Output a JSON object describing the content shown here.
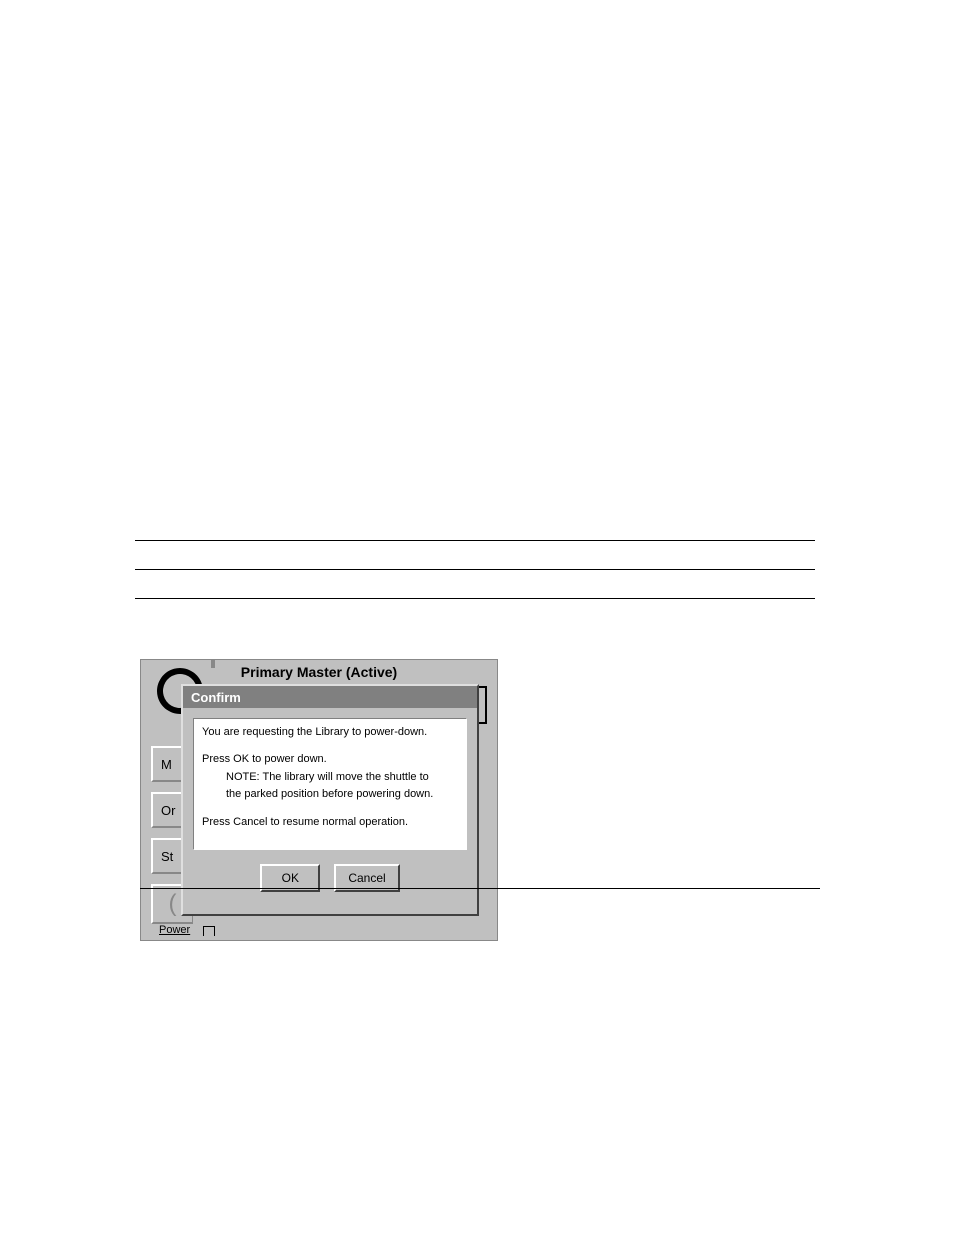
{
  "window": {
    "title": "Primary Master (Active)"
  },
  "sidebar": {
    "items": [
      "M",
      "Or",
      "St"
    ],
    "power_label": "Power"
  },
  "dialog": {
    "title": "Confirm",
    "message": {
      "line1": "You are requesting the Library to power-down.",
      "line2": "Press OK to power down.",
      "line3": "NOTE: The library will move the shuttle to",
      "line4": "the parked position before powering down.",
      "line5": "Press Cancel to resume normal operation."
    },
    "buttons": {
      "ok": "OK",
      "cancel": "Cancel"
    }
  }
}
